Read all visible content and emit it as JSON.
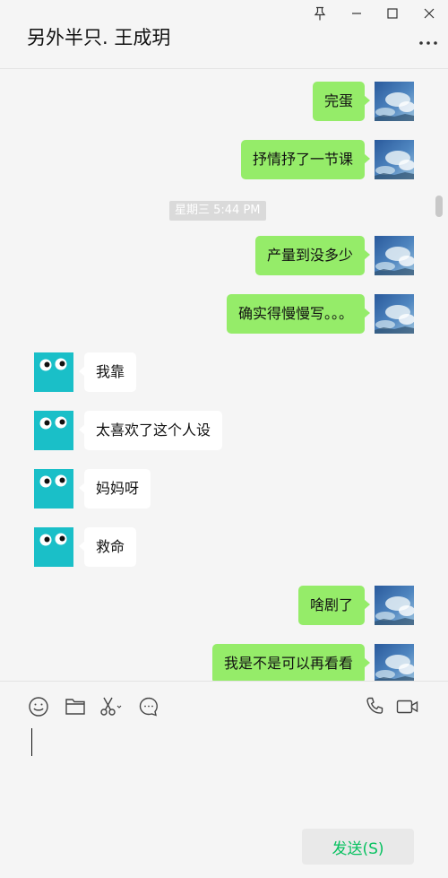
{
  "window": {
    "title": "另外半只. 王成玥",
    "controls": [
      "pin-icon",
      "minimize-icon",
      "maximize-icon",
      "close-icon"
    ]
  },
  "chat": {
    "messages": [
      {
        "direction": "out",
        "text": "完蛋"
      },
      {
        "direction": "out",
        "text": "抒情抒了一节课"
      },
      {
        "direction": "out",
        "text": "产量到没多少"
      },
      {
        "direction": "out",
        "text": "确实得慢慢写。。。"
      },
      {
        "direction": "in",
        "text": "我靠"
      },
      {
        "direction": "in",
        "text": "太喜欢了这个人设"
      },
      {
        "direction": "in",
        "text": "妈妈呀"
      },
      {
        "direction": "in",
        "text": "救命"
      },
      {
        "direction": "out",
        "text": "啥剧了"
      },
      {
        "direction": "out",
        "text": "我是不是可以再看看"
      }
    ],
    "timestamp": "星期三 5:44 PM"
  },
  "toolbar": {
    "left_icons": [
      "emoji-icon",
      "folder-icon",
      "scissors-icon",
      "chat-history-icon"
    ],
    "right_icons": [
      "phone-icon",
      "video-icon"
    ]
  },
  "composer": {
    "value": "",
    "send_label": "发送(S)"
  },
  "colors": {
    "background": "#f5f5f5",
    "outgoing_bubble": "#95ec69",
    "incoming_bubble": "#ffffff",
    "incoming_avatar": "#1abfc8",
    "send_text": "#07c160"
  }
}
